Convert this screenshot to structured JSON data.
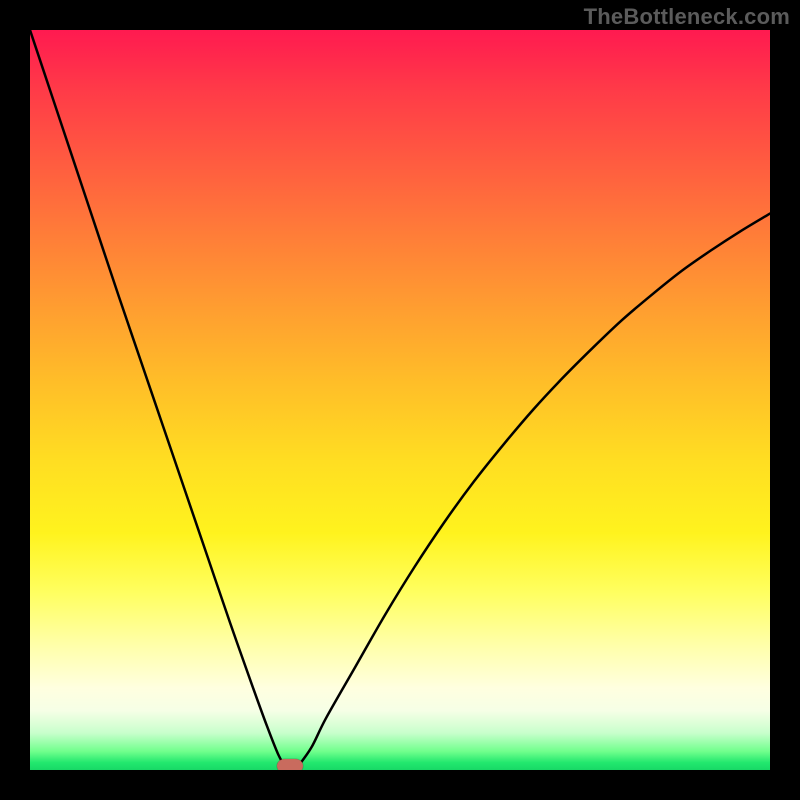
{
  "watermark": {
    "text": "TheBottleneck.com"
  },
  "colors": {
    "gradient_top": "#ff1a50",
    "gradient_bottom": "#18d866",
    "curve_stroke": "#000000",
    "marker_fill": "#c96b5e"
  },
  "chart_data": {
    "type": "line",
    "title": "",
    "xlabel": "",
    "ylabel": "",
    "grid": false,
    "legend": false,
    "xlim": [
      0,
      100
    ],
    "ylim": [
      0,
      100
    ],
    "annotations": [
      {
        "name": "watermark",
        "text": "TheBottleneck.com",
        "position": "top-right"
      }
    ],
    "series": [
      {
        "name": "left_branch",
        "x": [
          0.0,
          3.0,
          6.0,
          9.0,
          12.0,
          15.0,
          18.0,
          21.0,
          24.0,
          27.0,
          30.0,
          32.0,
          33.5,
          34.6
        ],
        "y": [
          100.0,
          91.0,
          82.0,
          73.0,
          64.0,
          55.2,
          46.4,
          37.6,
          28.8,
          20.0,
          11.5,
          6.0,
          2.2,
          0.2
        ]
      },
      {
        "name": "right_branch",
        "x": [
          36.0,
          38.0,
          40.0,
          44.0,
          48.0,
          52.0,
          56.0,
          60.0,
          64.0,
          68.0,
          72.0,
          76.0,
          80.0,
          84.0,
          88.0,
          92.0,
          96.0,
          100.0
        ],
        "y": [
          0.2,
          3.0,
          7.0,
          14.0,
          21.0,
          27.5,
          33.5,
          39.0,
          44.0,
          48.7,
          53.0,
          57.0,
          60.8,
          64.2,
          67.4,
          70.2,
          72.8,
          75.2
        ]
      }
    ],
    "marker": {
      "x_pct": 35.2,
      "y_pct": 0.0
    }
  }
}
